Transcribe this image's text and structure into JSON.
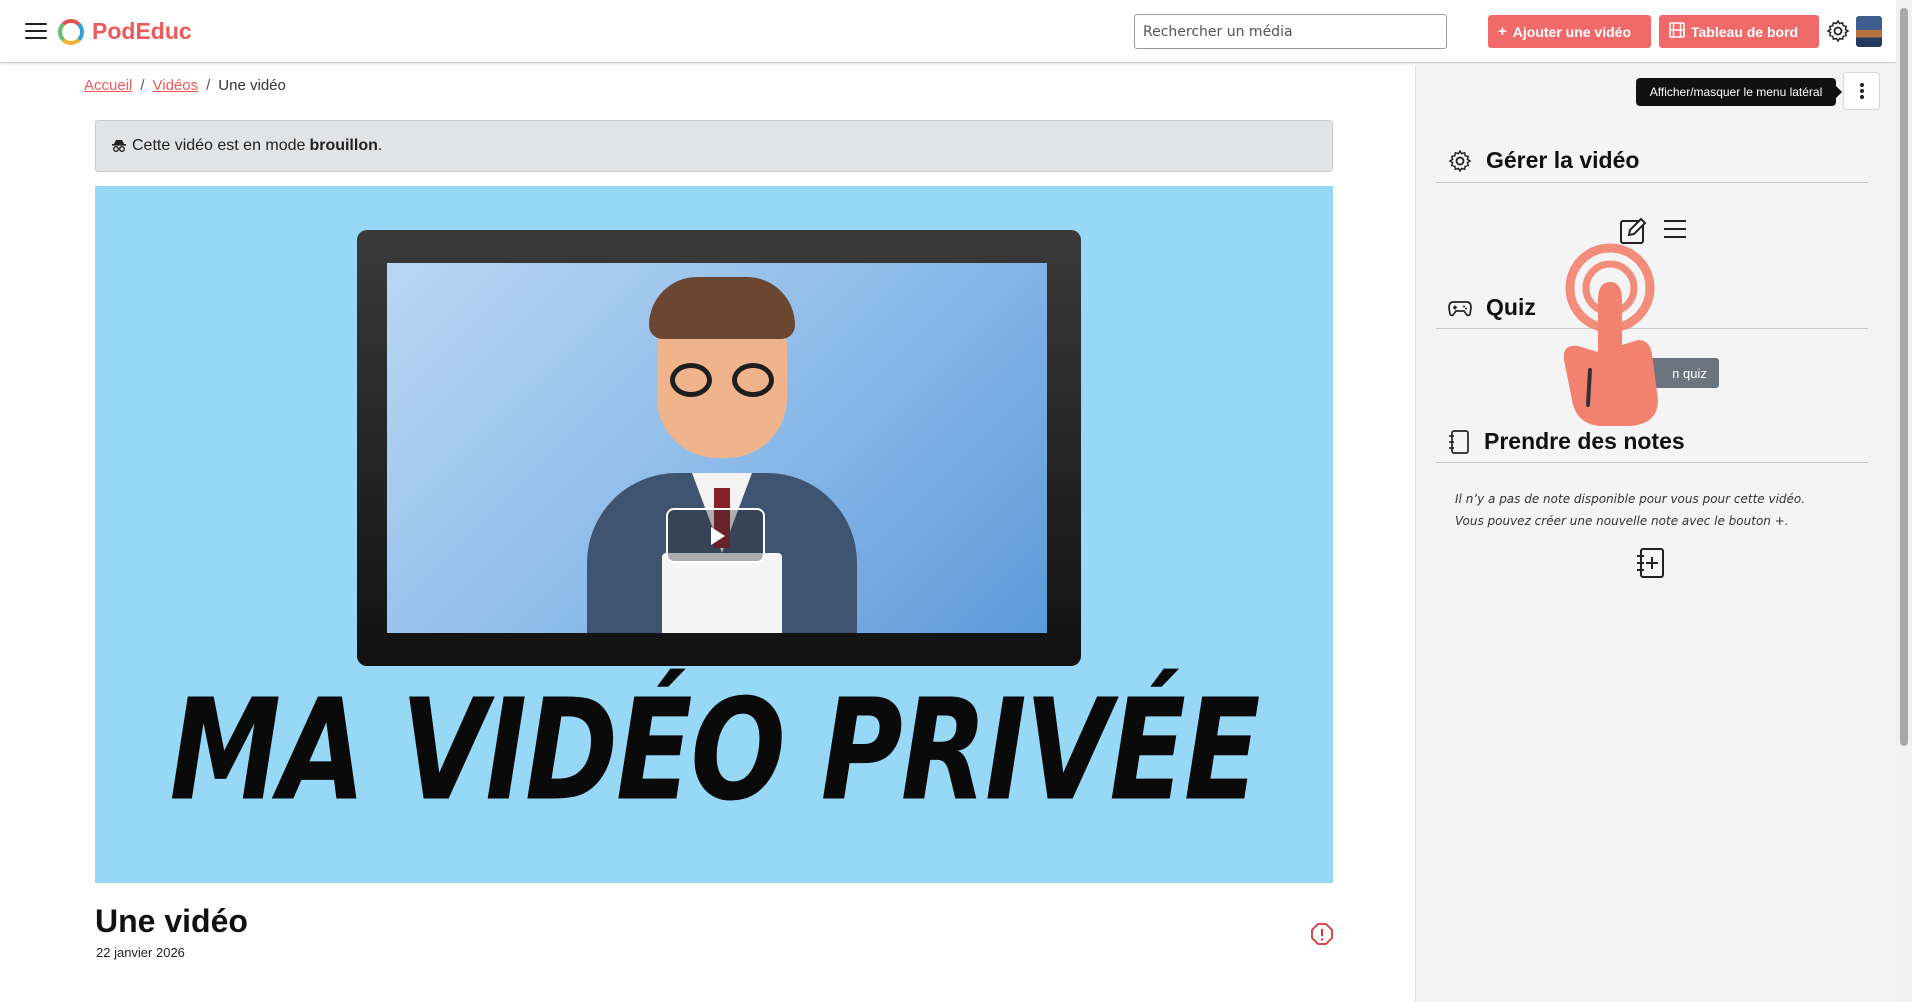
{
  "header": {
    "logo_text": "PodEduc",
    "search_placeholder": "Rechercher un média",
    "add_video_label": "Ajouter une vidéo",
    "dashboard_label": "Tableau de bord",
    "accent_color": "#f06a6a"
  },
  "breadcrumb": {
    "home": "Accueil",
    "sep1": "/",
    "videos": "Vidéos",
    "sep2": "/",
    "current": "Une vidéo"
  },
  "draft_notice": {
    "text": "Cette vidéo est en mode",
    "bold": "brouillon",
    "end": "."
  },
  "player": {
    "thumbnail_title": "MA VIDÉO PRIVÉE"
  },
  "video": {
    "title": "Une vidéo",
    "date": "22 janvier 2026"
  },
  "aside": {
    "tooltip": "Afficher/masquer le menu latéral",
    "manage_title": "Gérer la vidéo",
    "quiz_title": "Quiz",
    "quiz_button": "n quiz",
    "notes_title": "Prendre des notes",
    "notes_empty_line1": "Il n’y a pas de note disponible pour vous pour cette vidéo.",
    "notes_empty_line2": "Vous pouvez créer une nouvelle note avec le bouton +."
  }
}
